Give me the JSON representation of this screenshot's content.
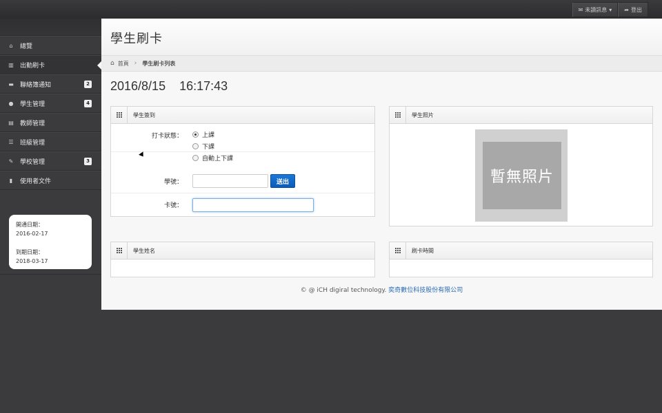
{
  "topnav": {
    "messages_label": "未讀訊息",
    "messages_icon": "envelope-icon",
    "logout_label": "登出",
    "logout_icon": "share-icon"
  },
  "sidebar": {
    "items": [
      {
        "label": "總覽",
        "icon": "home-icon",
        "badge": ""
      },
      {
        "label": "出勤刷卡",
        "icon": "barcode-icon",
        "badge": ""
      },
      {
        "label": "聯絡簿通知",
        "icon": "comment-icon",
        "badge": "2"
      },
      {
        "label": "學生管理",
        "icon": "user-icon",
        "badge": "4"
      },
      {
        "label": "教師管理",
        "icon": "briefcase-icon",
        "badge": ""
      },
      {
        "label": "班級管理",
        "icon": "list-icon",
        "badge": ""
      },
      {
        "label": "學校管理",
        "icon": "wrench-icon",
        "badge": "3"
      },
      {
        "label": "使用者文件",
        "icon": "file-icon",
        "badge": ""
      }
    ],
    "dates": {
      "open_label": "開通日期：",
      "open_value": "2016-02-17",
      "expire_label": "到期日期：",
      "expire_value": "2018-03-17"
    }
  },
  "page": {
    "title": "學生刷卡",
    "breadcrumb_home": "首頁",
    "breadcrumb_current": "學生刷卡列表",
    "date": "2016/8/15",
    "time": "16:17:43"
  },
  "checkin": {
    "title": "學生簽到",
    "status_label": "打卡狀態：",
    "options": [
      "上課",
      "下課",
      "自動上下課"
    ],
    "selected": "上課",
    "student_id_label": "學號：",
    "student_id_value": "",
    "submit_label": "送出",
    "card_label": "卡號：",
    "card_value": ""
  },
  "photo_panel": {
    "title": "學生照片",
    "placeholder": "暫無照片"
  },
  "name_panel": {
    "title": "學生姓名"
  },
  "time_panel": {
    "title": "刷卡時間"
  },
  "footer": {
    "text": "© @ iCH digiral technology.",
    "link": "奕奇數位科技股份有限公司"
  }
}
